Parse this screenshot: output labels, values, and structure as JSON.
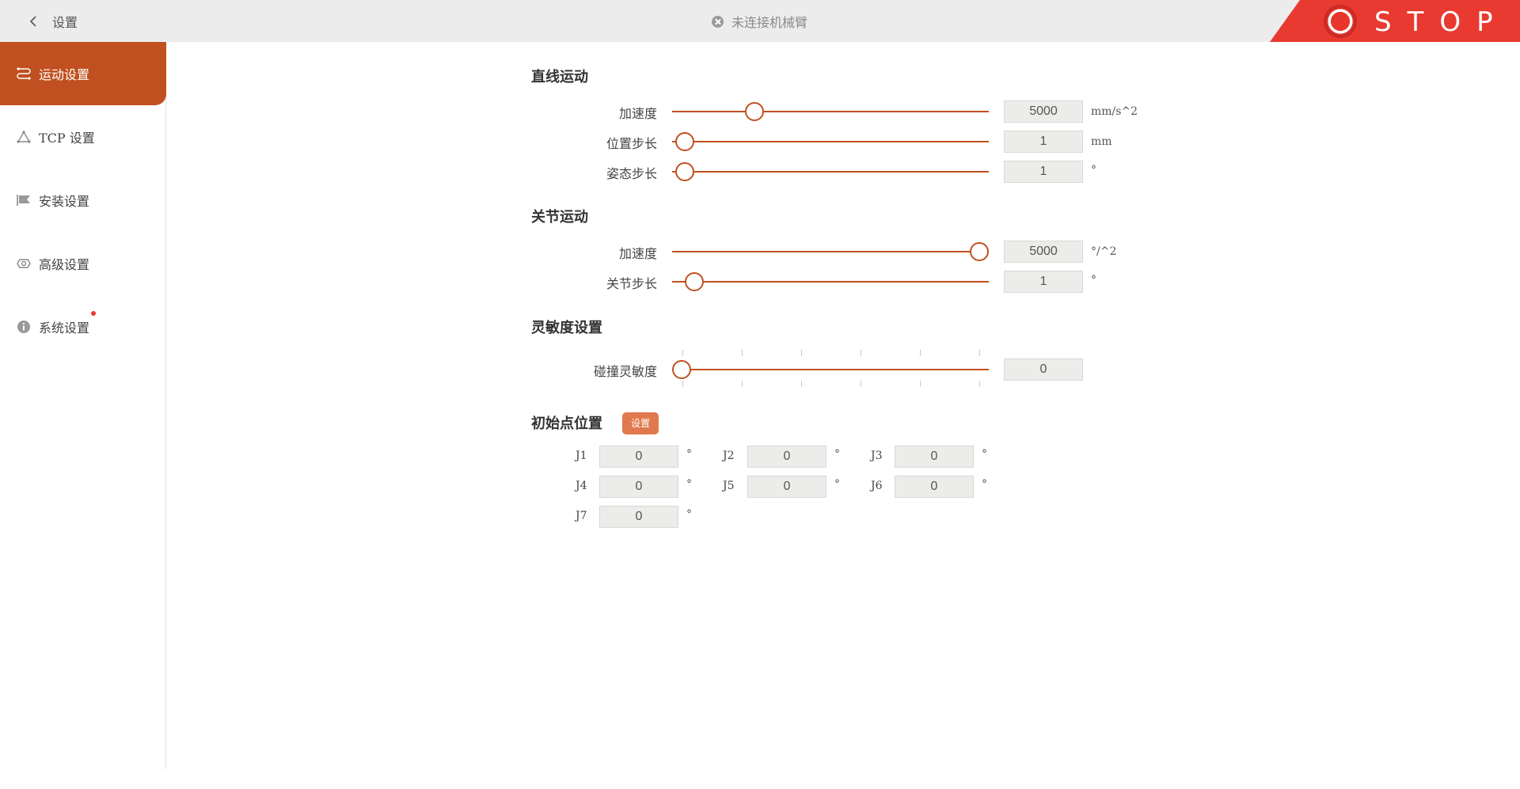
{
  "header": {
    "back_label": "设置",
    "connection_status": "未连接机械臂",
    "stop_label": "STOP",
    "stop_color": "#e83a30"
  },
  "sidebar": {
    "accent": "#c0501f",
    "items": [
      {
        "label": "运动设置",
        "icon": "motion-icon",
        "active": true
      },
      {
        "label": "TCP 设置",
        "icon": "tcp-triangle-icon",
        "active": false
      },
      {
        "label": "安装设置",
        "icon": "install-flag-icon",
        "active": false
      },
      {
        "label": "高级设置",
        "icon": "advanced-gear-icon",
        "active": false
      },
      {
        "label": "系统设置",
        "icon": "info-icon",
        "active": false,
        "badge": "red-dot"
      }
    ]
  },
  "linear_motion": {
    "title": "直线运动",
    "rows": [
      {
        "label": "加速度",
        "value": "5000",
        "unit": "mm/s^2",
        "slider_fraction": 0.26
      },
      {
        "label": "位置步长",
        "value": "1",
        "unit": "mm",
        "slider_fraction": 0.04
      },
      {
        "label": "姿态步长",
        "value": "1",
        "unit": "°",
        "slider_fraction": 0.04
      }
    ]
  },
  "joint_motion": {
    "title": "关节运动",
    "rows": [
      {
        "label": "加速度",
        "value": "5000",
        "unit": "°/^2",
        "slider_fraction": 0.97
      },
      {
        "label": "关节步长",
        "value": "1",
        "unit": "°",
        "slider_fraction": 0.07
      }
    ]
  },
  "sensitivity": {
    "title": "灵敏度设置",
    "rows": [
      {
        "label": "碰撞灵敏度",
        "value": "0",
        "slider_fraction": 0.03
      }
    ]
  },
  "home_position": {
    "title": "初始点位置",
    "set_button": "设置",
    "joints": [
      {
        "label": "J1",
        "value": "0",
        "unit": "°"
      },
      {
        "label": "J2",
        "value": "0",
        "unit": "°"
      },
      {
        "label": "J3",
        "value": "0",
        "unit": "°"
      },
      {
        "label": "J4",
        "value": "0",
        "unit": "°"
      },
      {
        "label": "J5",
        "value": "0",
        "unit": "°"
      },
      {
        "label": "J6",
        "value": "0",
        "unit": "°"
      },
      {
        "label": "J7",
        "value": "0",
        "unit": "°"
      }
    ]
  }
}
